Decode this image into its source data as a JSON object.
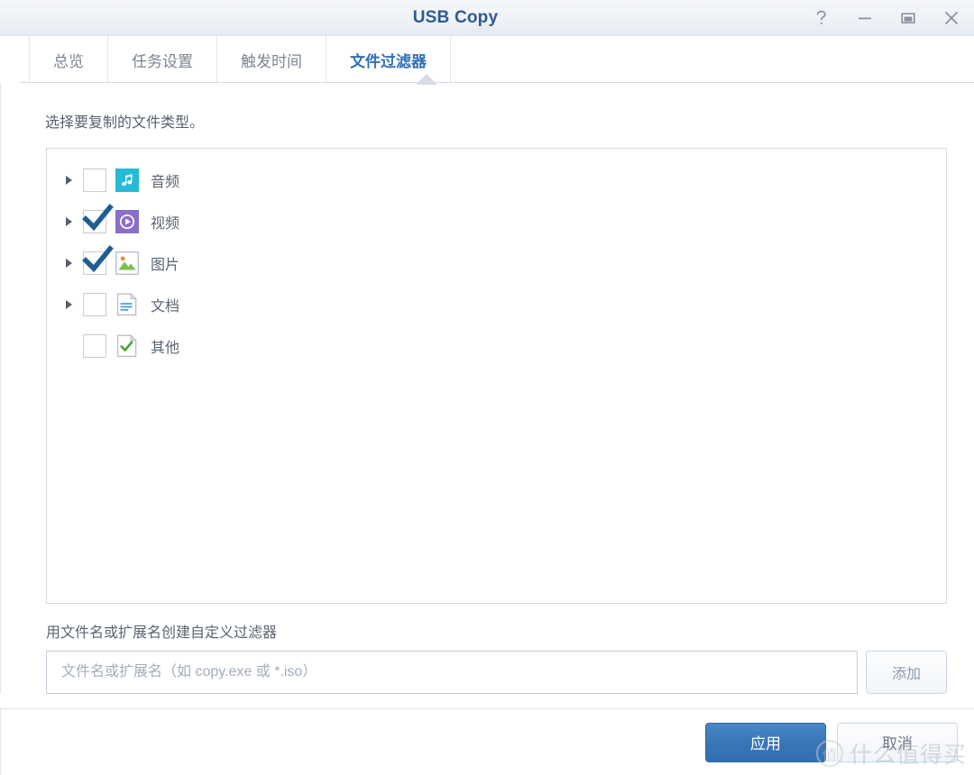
{
  "window": {
    "title": "USB Copy",
    "controls": [
      {
        "name": "help-icon",
        "label": "?"
      },
      {
        "name": "minimize-icon",
        "label": "—"
      },
      {
        "name": "maximize-icon",
        "label": "□"
      },
      {
        "name": "close-icon",
        "label": "✕"
      }
    ]
  },
  "tabs": [
    {
      "label": "总览",
      "active": false
    },
    {
      "label": "任务设置",
      "active": false
    },
    {
      "label": "触发时间",
      "active": false
    },
    {
      "label": "文件过滤器",
      "active": true
    }
  ],
  "main": {
    "instruction": "选择要复制的文件类型。",
    "file_types": [
      {
        "label": "音频",
        "checked": false,
        "expandable": true,
        "icon": "audio-icon",
        "color": "#26bad6"
      },
      {
        "label": "视频",
        "checked": true,
        "expandable": true,
        "icon": "video-icon",
        "color": "#8a6fc9"
      },
      {
        "label": "图片",
        "checked": true,
        "expandable": true,
        "icon": "image-icon",
        "color": "#ffffff"
      },
      {
        "label": "文档",
        "checked": false,
        "expandable": true,
        "icon": "document-icon",
        "color": "#ffffff"
      },
      {
        "label": "其他",
        "checked": false,
        "expandable": false,
        "icon": "other-file-icon",
        "color": "#ffffff"
      }
    ],
    "custom_filter_label": "用文件名或扩展名创建自定义过滤器",
    "filter_input": {
      "value": "",
      "placeholder": "文件名或扩展名（如 copy.exe 或 *.iso）"
    },
    "add_button_label": "添加"
  },
  "footer": {
    "apply_label": "应用",
    "cancel_label": "取消"
  },
  "watermark": {
    "mark": "值",
    "text": "什么值得买"
  },
  "colors": {
    "accent": "#2f6fb5",
    "primary_button": "#3a76b6",
    "title": "#2e5a90",
    "audio": "#26bad6",
    "video": "#8a6fc9",
    "image_sun": "#f08a33",
    "image_hill": "#7dbd52",
    "document_line": "#39a2e8",
    "other_check": "#46a832",
    "checkmark": "#1f5d93"
  }
}
